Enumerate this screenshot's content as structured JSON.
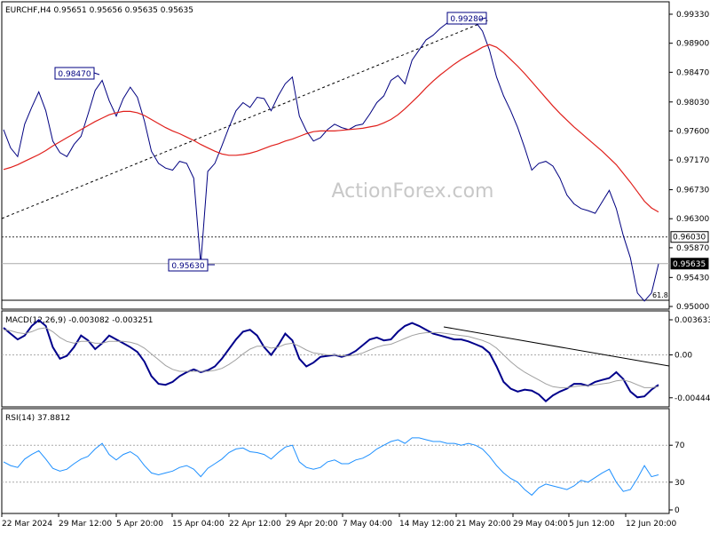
{
  "chart_data": {
    "type": "line",
    "symbol_header": "EURCHF,H4  0.95651 0.95656 0.95635 0.95635",
    "watermark": "ActionForex.com",
    "x_labels": [
      "22 Mar 2024",
      "29 Mar 12:00",
      "5 Apr 20:00",
      "15 Apr 04:00",
      "22 Apr 12:00",
      "29 Apr 20:00",
      "7 May 04:00",
      "14 May 12:00",
      "21 May 20:00",
      "29 May 04:00",
      "5 Jun 12:00",
      "12 Jun 20:00"
    ],
    "main_panel": {
      "ylim": [
        0.95,
        0.995
      ],
      "y_ticks": [
        "0.99330",
        "0.98900",
        "0.98470",
        "0.98030",
        "0.97600",
        "0.97170",
        "0.96730",
        "0.96300",
        "0.95870",
        "0.95430",
        "0.95000"
      ],
      "series": [
        {
          "name": "EURCHF,H4",
          "color": "#000080",
          "values": [
            0.9762,
            0.9735,
            0.9722,
            0.977,
            0.9795,
            0.9818,
            0.979,
            0.9745,
            0.9728,
            0.9722,
            0.974,
            0.9752,
            0.9785,
            0.982,
            0.9835,
            0.9805,
            0.9782,
            0.9808,
            0.9825,
            0.981,
            0.9775,
            0.973,
            0.9712,
            0.9705,
            0.9702,
            0.9715,
            0.9712,
            0.969,
            0.9563,
            0.97,
            0.9712,
            0.9738,
            0.9765,
            0.979,
            0.9802,
            0.9795,
            0.981,
            0.9808,
            0.979,
            0.9812,
            0.983,
            0.984,
            0.9782,
            0.976,
            0.9745,
            0.975,
            0.9762,
            0.977,
            0.9765,
            0.9762,
            0.9768,
            0.977,
            0.9785,
            0.9802,
            0.9812,
            0.9835,
            0.9842,
            0.983,
            0.9865,
            0.988,
            0.9895,
            0.9902,
            0.9912,
            0.992,
            0.9925,
            0.9918,
            0.9928,
            0.9922,
            0.9908,
            0.988,
            0.984,
            0.9812,
            0.979,
            0.9765,
            0.9735,
            0.9702,
            0.9712,
            0.9715,
            0.9708,
            0.969,
            0.9665,
            0.9652,
            0.9645,
            0.9642,
            0.9638,
            0.9655,
            0.9672,
            0.9645,
            0.9605,
            0.9572,
            0.952,
            0.9508,
            0.952,
            0.9563
          ]
        },
        {
          "name": "MA",
          "color": "#e0201c",
          "values": [
            0.9703,
            0.9706,
            0.971,
            0.9715,
            0.972,
            0.9725,
            0.9731,
            0.9738,
            0.9744,
            0.975,
            0.9756,
            0.9762,
            0.9768,
            0.9774,
            0.9779,
            0.9784,
            0.9787,
            0.9789,
            0.9789,
            0.9787,
            0.9783,
            0.9777,
            0.9771,
            0.9765,
            0.976,
            0.9756,
            0.9751,
            0.9746,
            0.974,
            0.9735,
            0.973,
            0.9726,
            0.9724,
            0.9724,
            0.9725,
            0.9727,
            0.973,
            0.9734,
            0.9738,
            0.9741,
            0.9745,
            0.9748,
            0.9752,
            0.9756,
            0.9759,
            0.976,
            0.976,
            0.976,
            0.9761,
            0.9762,
            0.9763,
            0.9764,
            0.9766,
            0.9768,
            0.9772,
            0.9777,
            0.9784,
            0.9793,
            0.9803,
            0.9813,
            0.9824,
            0.9834,
            0.9843,
            0.9851,
            0.9859,
            0.9866,
            0.9872,
            0.9878,
            0.9884,
            0.9888,
            0.9884,
            0.9876,
            0.9866,
            0.9856,
            0.9845,
            0.9833,
            0.9821,
            0.9809,
            0.9797,
            0.9786,
            0.9776,
            0.9766,
            0.9757,
            0.9748,
            0.9739,
            0.973,
            0.972,
            0.971,
            0.9697,
            0.9684,
            0.967,
            0.9656,
            0.9646,
            0.964
          ]
        }
      ],
      "price_labels": [
        {
          "text": "0.99280",
          "value": 0.9928
        },
        {
          "text": "0.98470",
          "value": 0.9847
        },
        {
          "text": "0.95630",
          "value": 0.9563
        }
      ],
      "right_marks": [
        {
          "text": "0.96030",
          "value": 0.9603
        },
        {
          "text": "0.95635",
          "value": 0.95635
        }
      ],
      "fib_label": "61.8"
    },
    "macd_panel": {
      "header": "MACD(12,26,9) -0.003082 -0.003251",
      "ylim": [
        -0.0052,
        0.004
      ],
      "y_ticks": [
        "0.003633",
        "0.00",
        "-0.004443"
      ],
      "series": [
        {
          "name": "MACD",
          "color": "#00008b",
          "values": [
            0.0028,
            0.0022,
            0.0016,
            0.002,
            0.003,
            0.0036,
            0.003,
            0.0008,
            -0.0004,
            -0.0001,
            0.0008,
            0.002,
            0.0015,
            0.0006,
            0.0012,
            0.002,
            0.0016,
            0.0012,
            0.0008,
            0.0003,
            -0.0007,
            -0.0022,
            -0.003,
            -0.0031,
            -0.0028,
            -0.0022,
            -0.0018,
            -0.0015,
            -0.0018,
            -0.0016,
            -0.0012,
            -0.0004,
            0.0006,
            0.0016,
            0.0024,
            0.0026,
            0.002,
            0.0008,
            0.0,
            0.001,
            0.0022,
            0.0015,
            -0.0004,
            -0.0012,
            -0.0008,
            -0.0002,
            -0.0001,
            0.0,
            -0.0002,
            0.0,
            0.0004,
            0.001,
            0.0016,
            0.0018,
            0.0015,
            0.0016,
            0.0024,
            0.003,
            0.0033,
            0.003,
            0.0026,
            0.0022,
            0.002,
            0.0018,
            0.0016,
            0.0016,
            0.0014,
            0.0011,
            0.0008,
            0.0002,
            -0.0012,
            -0.0028,
            -0.0035,
            -0.0038,
            -0.0036,
            -0.0037,
            -0.0041,
            -0.0048,
            -0.0042,
            -0.0038,
            -0.0035,
            -0.003,
            -0.003,
            -0.0032,
            -0.0028,
            -0.0026,
            -0.0024,
            -0.0018,
            -0.0025,
            -0.0038,
            -0.0044,
            -0.0043,
            -0.0036,
            -0.0031
          ]
        },
        {
          "name": "Signal",
          "color": "#a0a0a0",
          "values": [
            0.0026,
            0.0025,
            0.0023,
            0.0022,
            0.0024,
            0.0027,
            0.0028,
            0.0024,
            0.0018,
            0.0014,
            0.0012,
            0.0014,
            0.0014,
            0.0012,
            0.0012,
            0.0014,
            0.0014,
            0.0014,
            0.0013,
            0.0011,
            0.0007,
            0.0001,
            -0.0005,
            -0.0011,
            -0.0015,
            -0.0017,
            -0.0017,
            -0.0017,
            -0.0017,
            -0.0017,
            -0.0016,
            -0.0014,
            -0.001,
            -0.0005,
            0.0001,
            0.0006,
            0.0009,
            0.0009,
            0.0007,
            0.0008,
            0.0011,
            0.0012,
            0.0009,
            0.0005,
            0.0002,
            0.0001,
            0.0,
            0.0,
            -0.0001,
            -0.0001,
            0.0,
            0.0002,
            0.0005,
            0.0008,
            0.001,
            0.0011,
            0.0014,
            0.0017,
            0.002,
            0.0022,
            0.0023,
            0.0023,
            0.0023,
            0.0022,
            0.0021,
            0.002,
            0.0019,
            0.0017,
            0.0015,
            0.0012,
            0.0007,
            0.0,
            -0.0007,
            -0.0013,
            -0.0018,
            -0.0022,
            -0.0026,
            -0.003,
            -0.0033,
            -0.0034,
            -0.0034,
            -0.0033,
            -0.0032,
            -0.0032,
            -0.0031,
            -0.003,
            -0.0029,
            -0.0027,
            -0.0026,
            -0.0028,
            -0.0031,
            -0.0034,
            -0.0034,
            -0.0033
          ]
        }
      ]
    },
    "rsi_panel": {
      "header": "RSI(14) 37.8812",
      "ylim": [
        0,
        100
      ],
      "y_ticks": [
        "70",
        "30",
        "0"
      ],
      "levels": [
        70,
        30
      ],
      "series": [
        {
          "name": "RSI",
          "color": "#1e90ff",
          "values": [
            52,
            48,
            46,
            55,
            60,
            64,
            55,
            45,
            42,
            44,
            50,
            55,
            58,
            66,
            72,
            60,
            54,
            60,
            63,
            58,
            48,
            40,
            38,
            40,
            42,
            46,
            48,
            44,
            36,
            45,
            50,
            55,
            62,
            66,
            67,
            63,
            62,
            60,
            55,
            62,
            68,
            70,
            52,
            46,
            44,
            46,
            52,
            54,
            50,
            50,
            54,
            56,
            60,
            66,
            70,
            74,
            76,
            72,
            78,
            78,
            76,
            74,
            74,
            72,
            72,
            70,
            72,
            70,
            66,
            58,
            48,
            40,
            34,
            30,
            22,
            16,
            24,
            28,
            26,
            24,
            22,
            26,
            32,
            30,
            35,
            40,
            44,
            30,
            20,
            22,
            34,
            48,
            36,
            38
          ]
        }
      ]
    }
  }
}
